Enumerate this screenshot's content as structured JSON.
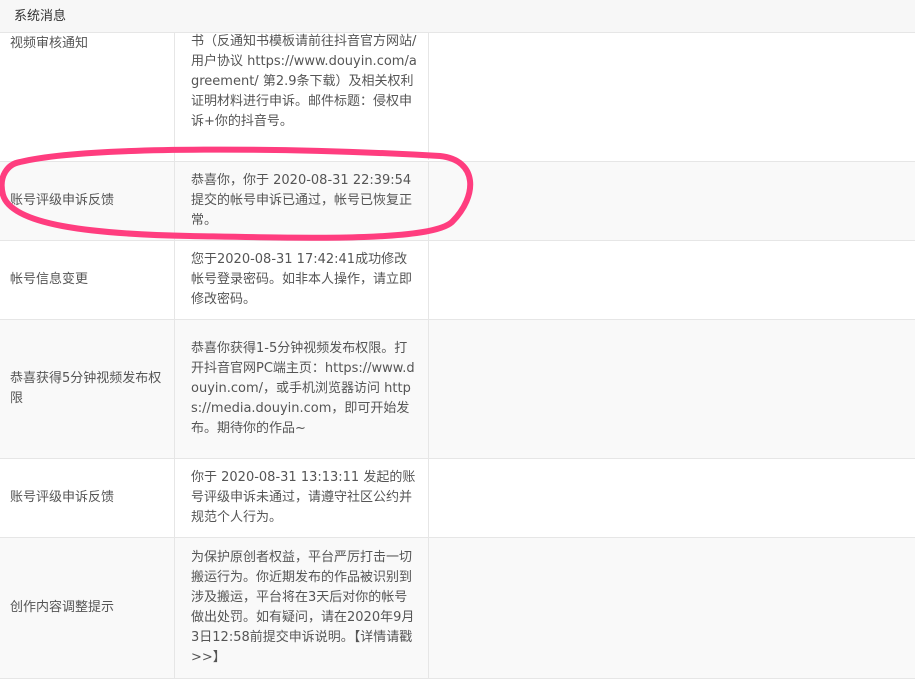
{
  "header": {
    "title": "系统消息"
  },
  "rows": [
    {
      "type": "视频审核通知",
      "message": "书（反通知书模板请前往抖音官方网站/用户协议 https://www.douyin.com/agreement/ 第2.9条下载）及相关权利证明材料进行申诉。邮件标题：侵权申诉+你的抖音号。"
    },
    {
      "type": "账号评级申诉反馈",
      "message": "恭喜你，你于 2020-08-31 22:39:54 提交的帐号申诉已通过，帐号已恢复正常。"
    },
    {
      "type": "帐号信息变更",
      "message": "您于2020-08-31 17:42:41成功修改帐号登录密码。如非本人操作，请立即修改密码。"
    },
    {
      "type": "恭喜获得5分钟视频发布权限",
      "message": "恭喜你获得1-5分钟视频发布权限。打开抖音官网PC端主页：https://www.douyin.com/，或手机浏览器访问 https://media.douyin.com，即可开始发布。期待你的作品~"
    },
    {
      "type": "账号评级申诉反馈",
      "message": "你于 2020-08-31 13:13:11 发起的账号评级申诉未通过，请遵守社区公约并规范个人行为。"
    },
    {
      "type": "创作内容调整提示",
      "message": "为保护原创者权益，平台严厉打击一切搬运行为。你近期发布的作品被识别到涉及搬运，平台将在3天后对你的帐号做出处罚。如有疑问，请在2020年9月3日12:58前提交申诉说明。【详情请戳>>】"
    }
  ],
  "annotation": {
    "color": "#ff3d7f"
  }
}
